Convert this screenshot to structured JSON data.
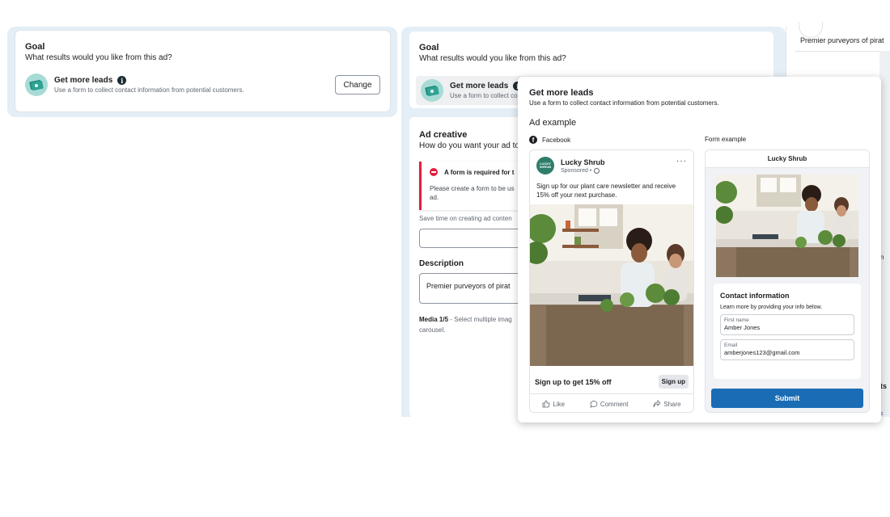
{
  "goal_panel": {
    "title": "Goal",
    "subtitle": "What results would you like from this ad?",
    "option_label": "Get more leads",
    "option_desc": "Use a form to collect contact information from potential customers.",
    "change_label": "Change"
  },
  "editor": {
    "goal_title": "Goal",
    "goal_subtitle": "What results would you like from this ad?",
    "goal_option_label": "Get more leads",
    "goal_option_desc": "Use a form to collect contact information from potential customers.",
    "creative_title": "Ad creative",
    "creative_subtitle": "How do you want your ad to",
    "alert_title": "A form is required for t",
    "alert_body": "Please create a form to be us ad.",
    "hint": "Save time on creating ad conten",
    "description_label": "Description",
    "description_value": "Premier purveyors of pirat",
    "media_label": "Media 1/5",
    "media_text": "- Select multiple imag",
    "media_text2": "carousel."
  },
  "right_panel": {
    "text": "Premier purveyors of pirat",
    "frag1": "n",
    "frag2": "ts",
    "frag3": "s"
  },
  "popup": {
    "title": "Get more leads",
    "subtitle": "Use a form to collect contact information from potential customers.",
    "section": "Ad example",
    "fb_label": "Facebook",
    "form_label": "Form example",
    "ad": {
      "brand": "Lucky Shrub",
      "logo_text": "LUCKY SHRUB",
      "sponsored": "Sponsored •",
      "text": "Sign up for our plant care newsletter and receive 15% off your next purchase.",
      "cta_text": "Sign up to get 15% off",
      "cta_button": "Sign up",
      "like": "Like",
      "comment": "Comment",
      "share": "Share"
    },
    "form": {
      "brand": "Lucky Shrub",
      "contact_title": "Contact information",
      "contact_sub": "Learn more by providing your info below.",
      "first_name_label": "First name",
      "first_name_value": "Amber Jones",
      "email_label": "Email",
      "email_value": "amberjones123@gmail.com",
      "submit": "Submit"
    }
  },
  "colors": {
    "panel_bg": "#e4eef6",
    "alert_red": "#e41e3f",
    "submit_blue": "#1a6cb5",
    "goal_icon_bg": "#a8dbd6"
  }
}
